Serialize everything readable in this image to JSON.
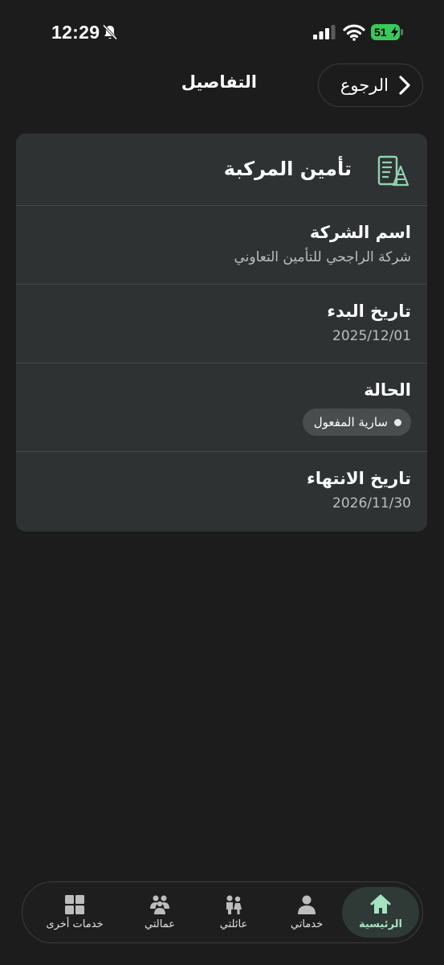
{
  "status_bar": {
    "time": "12:29",
    "battery": "51"
  },
  "header": {
    "back_label": "الرجوع",
    "title": "التفاصيل"
  },
  "card": {
    "title": "تأمين المركبة",
    "fields": [
      {
        "label": "اسم الشركة",
        "value": "شركة الراجحي للتأمين التعاوني"
      },
      {
        "label": "تاريخ البدء",
        "value": "2025/12/01"
      },
      {
        "label": "الحالة",
        "badge": "سارية المفعول"
      },
      {
        "label": "تاريخ الانتهاء",
        "value": "2026/11/30"
      }
    ]
  },
  "bottom_nav": {
    "items": [
      {
        "label": "الرئيسية",
        "icon": "home-icon",
        "active": true
      },
      {
        "label": "خدماتي",
        "icon": "person-icon"
      },
      {
        "label": "عائلتي",
        "icon": "family-icon"
      },
      {
        "label": "عمالتي",
        "icon": "workers-icon"
      },
      {
        "label": "خدمات أخرى",
        "icon": "grid-icon"
      }
    ]
  },
  "colors": {
    "background": "#1c1c1c",
    "card": "#2f3232",
    "accent": "#a6e3c0",
    "battery": "#38c95a"
  }
}
